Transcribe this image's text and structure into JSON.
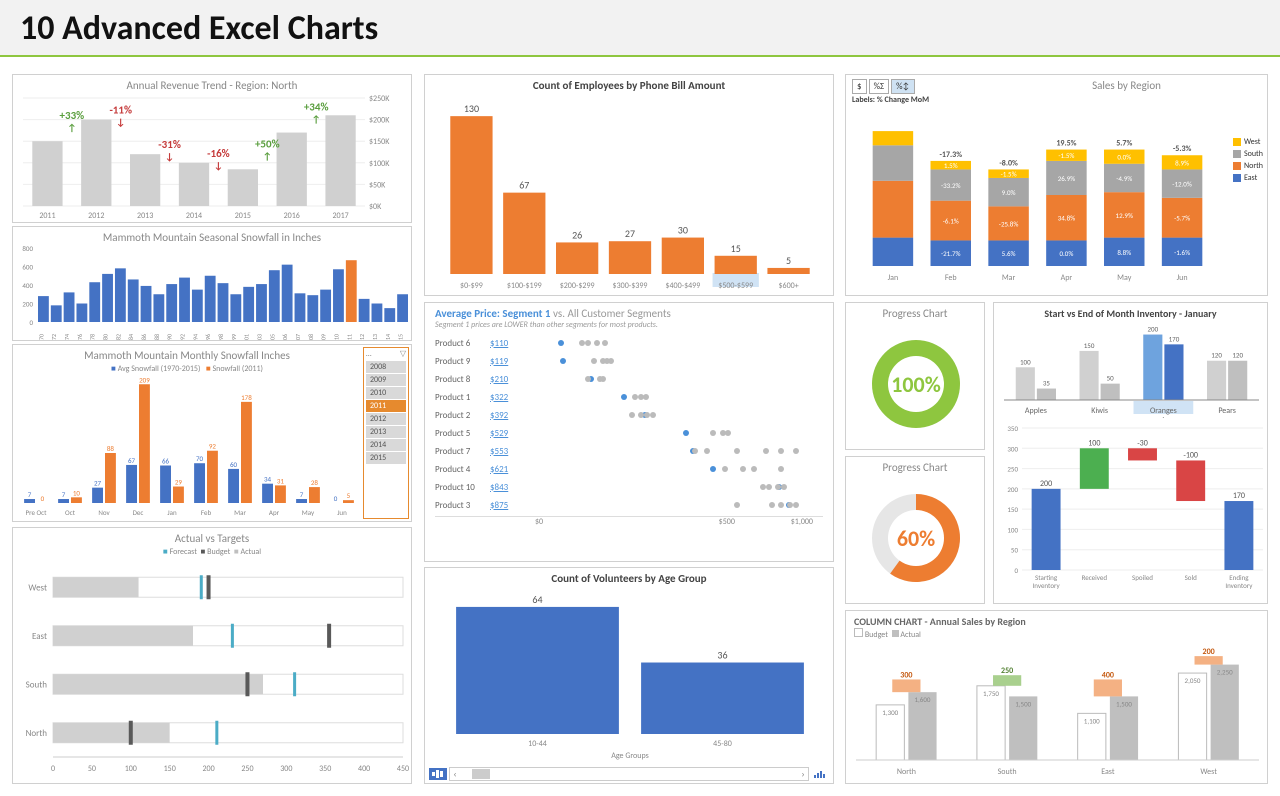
{
  "page_title": "10 Advanced Excel Charts",
  "chart_data": [
    {
      "id": "revenue",
      "type": "bar",
      "title": "Annual Revenue Trend - Region: North",
      "categories": [
        "2011",
        "2012",
        "2013",
        "2014",
        "2015",
        "2016",
        "2017"
      ],
      "values": [
        150,
        200,
        120,
        100,
        85,
        170,
        210
      ],
      "ylabel": "",
      "ylim": [
        0,
        250
      ],
      "y_ticks": [
        "$0K",
        "$50K",
        "$100K",
        "$150K",
        "$200K",
        "$250K"
      ],
      "annotations": [
        {
          "i": 0,
          "text": "+33%",
          "dir": "up"
        },
        {
          "i": 1,
          "text": "-11%",
          "dir": "down"
        },
        {
          "i": 2,
          "text": "-31%",
          "dir": "down"
        },
        {
          "i": 3,
          "text": "-16%",
          "dir": "down"
        },
        {
          "i": 4,
          "text": "+50%",
          "dir": "up"
        },
        {
          "i": 5,
          "text": "+34%",
          "dir": "up"
        }
      ]
    },
    {
      "id": "seasonal",
      "type": "bar",
      "title": "Mammoth Mountain Seasonal Snowfall in Inches",
      "categories": [
        "1970",
        "1972",
        "1974",
        "1976",
        "1978",
        "1980",
        "1982",
        "1984",
        "1986",
        "1988",
        "1990",
        "1992",
        "1994",
        "1996",
        "1998",
        "1999",
        "2001",
        "2003",
        "2005",
        "2006",
        "2007",
        "2008",
        "2009",
        "2010",
        "2011",
        "2012",
        "2013",
        "2014",
        "2015"
      ],
      "values": [
        280,
        180,
        320,
        200,
        430,
        520,
        580,
        460,
        390,
        300,
        410,
        480,
        350,
        500,
        420,
        300,
        380,
        410,
        560,
        620,
        310,
        290,
        350,
        570,
        668,
        250,
        200,
        150,
        300
      ],
      "highlight_index": 24,
      "ylim": [
        0,
        800
      ],
      "y_ticks": [
        0,
        200,
        400,
        600,
        800
      ]
    },
    {
      "id": "monthly",
      "type": "bar",
      "title": "Mammoth Mountain Monthly Snowfall Inches",
      "categories": [
        "Pre Oct",
        "Oct",
        "Nov",
        "Dec",
        "Jan",
        "Feb",
        "Mar",
        "Apr",
        "May",
        "Jun"
      ],
      "series": [
        {
          "name": "Avg Snowfall (1970-2015)",
          "values": [
            7,
            7,
            27,
            67,
            66,
            70,
            60,
            34,
            7,
            0
          ],
          "color": "#4472c4"
        },
        {
          "name": "Snowfall (2011)",
          "values": [
            0,
            10,
            88,
            209,
            29,
            92,
            178,
            31,
            28,
            5
          ],
          "color": "#ed7d31"
        }
      ],
      "slicer": {
        "items": [
          "2008",
          "2009",
          "2010",
          "2011",
          "2012",
          "2013",
          "2014",
          "2015"
        ],
        "selected": "2011"
      }
    },
    {
      "id": "bullet",
      "type": "bar",
      "title": "Actual vs Targets",
      "legend": [
        "Forecast",
        "Budget",
        "Actual"
      ],
      "categories": [
        "West",
        "East",
        "South",
        "North"
      ],
      "actual": [
        110,
        180,
        270,
        150
      ],
      "budget": [
        200,
        355,
        250,
        100
      ],
      "forecast": [
        190,
        230,
        310,
        210
      ],
      "xlim": [
        0,
        450
      ],
      "x_ticks": [
        0,
        50,
        100,
        150,
        200,
        250,
        300,
        350,
        400,
        450
      ]
    },
    {
      "id": "phone",
      "type": "bar",
      "title": "Count of Employees by Phone Bill Amount",
      "categories": [
        "$0-$99",
        "$100-$199",
        "$200-$299",
        "$300-$399",
        "$400-$499",
        "$500-$599",
        "$600+"
      ],
      "values": [
        130,
        67,
        26,
        27,
        30,
        15,
        5
      ],
      "selected_index": 5
    },
    {
      "id": "segment",
      "type": "scatter",
      "title": "Average Price: Segment 1 vs. All Customer Segments",
      "note": "Segment 1 prices are LOWER than other segments for most products.",
      "xlabel": "",
      "xlim": [
        0,
        1000
      ],
      "x_ticks": [
        "$0",
        "$500",
        "$1,000"
      ],
      "rows": [
        {
          "name": "Product 6",
          "seg1": 110,
          "others": [
            180,
            200,
            230,
            260
          ]
        },
        {
          "name": "Product 9",
          "seg1": 119,
          "others": [
            220,
            250,
            265,
            280
          ]
        },
        {
          "name": "Product 8",
          "seg1": 210,
          "others": [
            200,
            240,
            250
          ]
        },
        {
          "name": "Product 1",
          "seg1": 322,
          "others": [
            360,
            380,
            395
          ]
        },
        {
          "name": "Product 2",
          "seg1": 392,
          "others": [
            350,
            380,
            400,
            420
          ]
        },
        {
          "name": "Product 5",
          "seg1": 529,
          "others": [
            620,
            655,
            670
          ]
        },
        {
          "name": "Product 7",
          "seg1": 553,
          "others": [
            560,
            600,
            700,
            800,
            850,
            900
          ]
        },
        {
          "name": "Product 4",
          "seg1": 621,
          "others": [
            660,
            720,
            760,
            850
          ]
        },
        {
          "name": "Product 10",
          "seg1": 843,
          "others": [
            790,
            810,
            840,
            860
          ]
        },
        {
          "name": "Product 3",
          "seg1": 875,
          "others": [
            700,
            820,
            850,
            880,
            900
          ]
        }
      ]
    },
    {
      "id": "volunteers",
      "type": "bar",
      "title": "Count of Volunteers by Age Group",
      "categories": [
        "10-44",
        "45-80"
      ],
      "values": [
        64,
        36
      ],
      "xlabel": "Age Groups"
    },
    {
      "id": "sales_region",
      "type": "bar",
      "title": "Sales by Region",
      "toggles": [
        "$",
        "%Σ",
        "%↕"
      ],
      "toggle_selected": 2,
      "labels_text": "Labels: % Change MoM",
      "categories": [
        "Jan",
        "Feb",
        "Mar",
        "Apr",
        "May",
        "Jun"
      ],
      "series": [
        {
          "name": "West",
          "color": "#ffc000"
        },
        {
          "name": "South",
          "color": "#a6a6a6"
        },
        {
          "name": "North",
          "color": "#ed7d31"
        },
        {
          "name": "East",
          "color": "#4472c4"
        }
      ],
      "heights": [
        [
          10,
          25,
          40,
          20
        ],
        [
          6,
          22,
          28,
          18
        ],
        [
          6,
          20,
          24,
          18
        ],
        [
          8,
          24,
          32,
          18
        ],
        [
          10,
          20,
          32,
          20
        ],
        [
          10,
          20,
          28,
          20
        ]
      ],
      "totals": [
        "",
        "-17.3%",
        "-8.0%",
        "19.5%",
        "5.7%",
        "-5.3%"
      ],
      "cell_labels": [
        [
          "",
          "",
          "",
          ""
        ],
        [
          "1.5%",
          "-33.2%",
          "-6.1%",
          "-21.7%"
        ],
        [
          "-1.5%",
          "9.0%",
          "-25.8%",
          "5.6%"
        ],
        [
          "-1.5%",
          "26.9%",
          "34.8%",
          "0.0%"
        ],
        [
          "0.0%",
          "-4.9%",
          "12.9%",
          "8.8%"
        ],
        [
          "8.9%",
          "-12.0%",
          "-5.7%",
          "-1.6%"
        ]
      ]
    },
    {
      "id": "progress1",
      "type": "pie",
      "title": "Progress Chart",
      "value": 100,
      "color": "#8ec63f"
    },
    {
      "id": "progress2",
      "type": "pie",
      "title": "Progress Chart",
      "value": 60,
      "color": "#ed7d31"
    },
    {
      "id": "inventory_prod",
      "type": "bar",
      "title": "Start vs End of Month Inventory - January",
      "categories": [
        "Apples",
        "Kiwis",
        "Oranges",
        "Pears"
      ],
      "start": [
        100,
        150,
        200,
        120
      ],
      "end": [
        35,
        50,
        170,
        120
      ],
      "selected": "Oranges"
    },
    {
      "id": "waterfall",
      "type": "bar",
      "categories": [
        "Starting Inventory",
        "Received",
        "Spoiled",
        "Sold",
        "Ending Inventory"
      ],
      "values": [
        200,
        100,
        -30,
        -100,
        170
      ],
      "ylim": [
        0,
        350
      ],
      "y_ticks": [
        0,
        50,
        100,
        150,
        200,
        250,
        300,
        350
      ]
    },
    {
      "id": "annual_sales",
      "type": "bar",
      "title": "COLUMN CHART - Annual Sales by Region",
      "legend": [
        "Budget",
        "Actual"
      ],
      "categories": [
        "North",
        "South",
        "East",
        "West"
      ],
      "budget": [
        1300,
        1750,
        1100,
        2050
      ],
      "actual": [
        1600,
        1500,
        1500,
        2250
      ],
      "diff": [
        300,
        250,
        400,
        200
      ],
      "diff_pos": [
        true,
        false,
        true,
        true
      ]
    }
  ]
}
